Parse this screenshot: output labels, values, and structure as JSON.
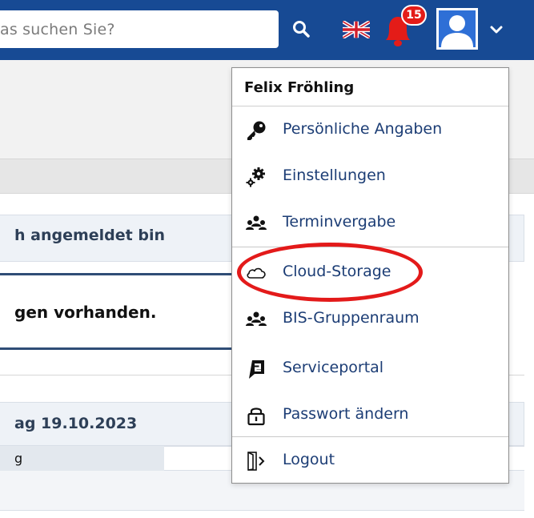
{
  "search": {
    "placeholder": "as suchen Sie?"
  },
  "header": {
    "notification_count": "15",
    "language_flag": "uk-flag-icon",
    "colors": {
      "bar": "#174a94",
      "badge": "#e41c18",
      "bell": "#e41c18"
    }
  },
  "background": {
    "card_title": "h angemeldet bin",
    "info_text": "gen vorhanden.",
    "card2_title": "ag 19.10.2023",
    "row_label": "g"
  },
  "menu": {
    "user_name": "Felix Fröhling",
    "items": [
      {
        "label": "Persönliche Angaben",
        "icon": "key-icon"
      },
      {
        "label": "Einstellungen",
        "icon": "gears-icon"
      },
      {
        "label": "Terminvergabe",
        "icon": "people-icon"
      },
      {
        "label": "Cloud-Storage",
        "icon": "cloud-icon"
      },
      {
        "label": "BIS-Gruppenraum",
        "icon": "people-icon"
      },
      {
        "label": "Serviceportal",
        "icon": "serviceportal-icon"
      },
      {
        "label": "Passwort ändern",
        "icon": "lock-icon"
      },
      {
        "label": "Logout",
        "icon": "logout-icon"
      }
    ],
    "highlight_color": "#e31a1a"
  }
}
